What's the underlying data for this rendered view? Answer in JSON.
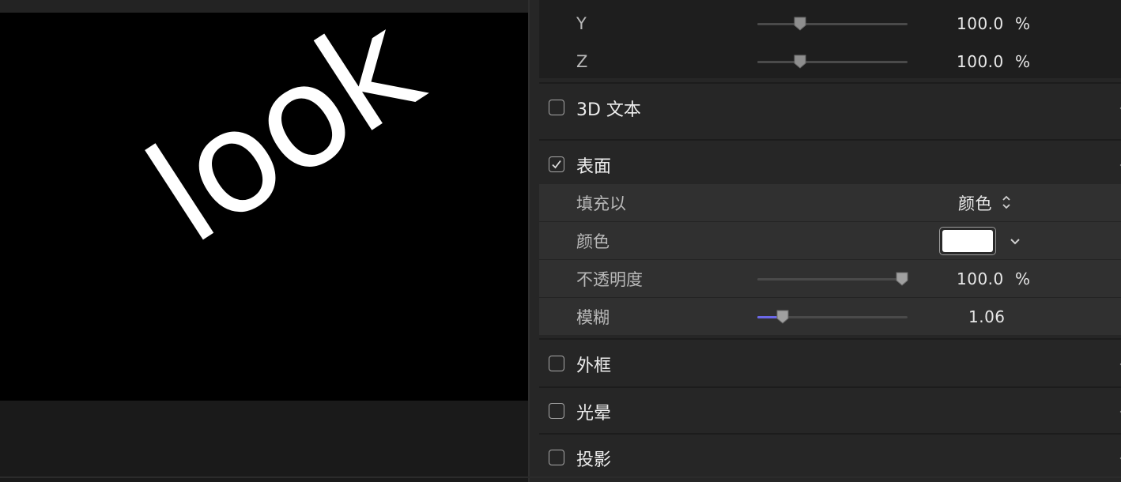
{
  "viewer": {
    "canvas_text": "look"
  },
  "inspector": {
    "scale": {
      "y": {
        "label": "Y",
        "value": "100.0",
        "unit": "%",
        "slider_level": 0.26
      },
      "z": {
        "label": "Z",
        "value": "100.0",
        "unit": "%",
        "slider_level": 0.26
      }
    },
    "sections": {
      "text3d": {
        "label": "3D 文本",
        "checked": false
      },
      "face": {
        "label": "表面",
        "checked": true
      },
      "outline": {
        "label": "外框",
        "checked": false
      },
      "glow": {
        "label": "光晕",
        "checked": false
      },
      "shadow": {
        "label": "投影",
        "checked": false
      }
    },
    "face": {
      "fill_with": {
        "label": "填充以",
        "value": "颜色"
      },
      "color": {
        "label": "颜色",
        "swatch_color": "#ffffff"
      },
      "opacity": {
        "label": "不透明度",
        "value": "100.0",
        "unit": "%",
        "slider_level": 1.0
      },
      "blur": {
        "label": "模糊",
        "value": "1.06",
        "slider_level": 0.13
      }
    },
    "colors": {
      "accent": "#6b68e8",
      "panel_bg": "#262626",
      "row_bg": "#303030",
      "canvas_bg": "#000000"
    }
  }
}
